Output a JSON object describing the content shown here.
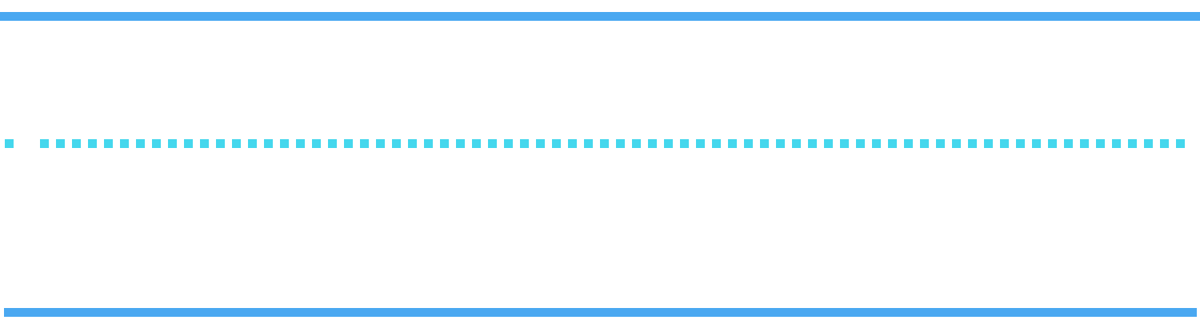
{
  "colors": {
    "background": "#ffffff",
    "rule": "#4aa8f1",
    "dots": "#44d7ed"
  }
}
